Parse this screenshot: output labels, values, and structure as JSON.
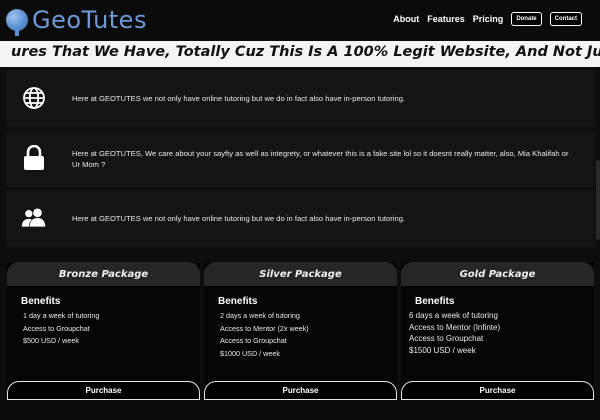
{
  "header": {
    "logo_text": "GeoTutes",
    "nav": {
      "about": "About",
      "features": "Features",
      "pricing": "Pricing",
      "donate": "Donate",
      "contact": "Contact"
    }
  },
  "banner": {
    "text": "ures That We Have, Totally Cuz This Is A 100% Legit Website, And Not Just For My Certification !"
  },
  "features": [
    {
      "icon": "globe-icon",
      "text": "Here at GEOTUTES we not only have online tutoring but we do in fact also have in-person tutoring."
    },
    {
      "icon": "lock-icon",
      "text": "Here at GEOTUTES, We care about your sayfty as well as integrety, or whatever this is a fake site lol so it doesnt really matter, also, Mia Khalifah or Ur Mom ?"
    },
    {
      "icon": "users-icon",
      "text": "Here at GEOTUTES we not only have online tutoring but we do in fact also have in-person tutoring."
    }
  ],
  "packages": [
    {
      "title": "Bronze Package",
      "benefits_label": "Benefits",
      "lines": [
        "1 day a week of tutoring",
        "Access to Groupchat",
        "$500 USD / week"
      ],
      "button": "Purchase"
    },
    {
      "title": "Silver Package",
      "benefits_label": "Benefits",
      "lines": [
        "2 days a week of tutoring",
        "Access to Mentor (2x week)",
        "Access to Groupchat",
        "$1000 USD / week"
      ],
      "button": "Purchase"
    },
    {
      "title": "Gold Package",
      "benefits_label": "Benefits",
      "lines": [
        "6 days a week of tutoring",
        "Access to Mentor (Infinte)",
        "Access to Groupchat",
        "$1500 USD / week"
      ],
      "button": "Purchase"
    }
  ]
}
